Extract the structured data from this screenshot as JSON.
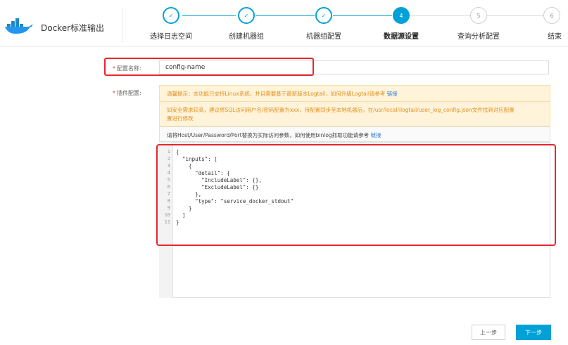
{
  "app": {
    "title": "Docker标准输出",
    "logo_icon": "docker-whale-icon",
    "accent_color": "#00a1d6"
  },
  "steps": [
    {
      "label": "选择日志空间",
      "state": "done",
      "marker": "✓"
    },
    {
      "label": "创建机器组",
      "state": "done",
      "marker": "✓"
    },
    {
      "label": "机器组配置",
      "state": "done",
      "marker": "✓"
    },
    {
      "label": "数据源设置",
      "state": "active",
      "marker": "4"
    },
    {
      "label": "查询分析配置",
      "state": "todo",
      "marker": "5"
    },
    {
      "label": "结束",
      "state": "todo",
      "marker": "6"
    }
  ],
  "form": {
    "config_name_label": "配置名称:",
    "config_name_value": "config-name",
    "plugin_label": "插件配置:",
    "required_mark": "*",
    "notice_1_text": "温馨提示：本功能只支持Linux系统，并且需要基于最新版本Logtail，如何升级Logtail请参考",
    "notice_1_link": "链接",
    "notice_2_line1": "如安全需求较高，建议将SQL访问用户名/密码配置为xxx，待配置同步至本地机器后，在/usr/local/ilogtail/user_log_config.json文件找到对应配置",
    "notice_2_line2": "置进行修改",
    "help_text": "请将Host/User/Password/Port替换为实际访问参数，如何使用binlog抓取功能请参考",
    "help_link": "链接"
  },
  "code_lines": [
    {
      "n": "1",
      "t": "{"
    },
    {
      "n": "2",
      "t": "  \"inputs\": ["
    },
    {
      "n": "3",
      "t": "    {"
    },
    {
      "n": "4",
      "t": "      \"detail\": {"
    },
    {
      "n": "5",
      "t": "        \"IncludeLabel\": {},"
    },
    {
      "n": "6",
      "t": "        \"ExcludeLabel\": {}"
    },
    {
      "n": "7",
      "t": "      },"
    },
    {
      "n": "8",
      "t": "      \"type\": \"service_docker_stdout\""
    },
    {
      "n": "9",
      "t": "    }"
    },
    {
      "n": "10",
      "t": "  ]"
    },
    {
      "n": "11",
      "t": "}"
    }
  ],
  "buttons": {
    "prev": "上一步",
    "next": "下一步"
  }
}
